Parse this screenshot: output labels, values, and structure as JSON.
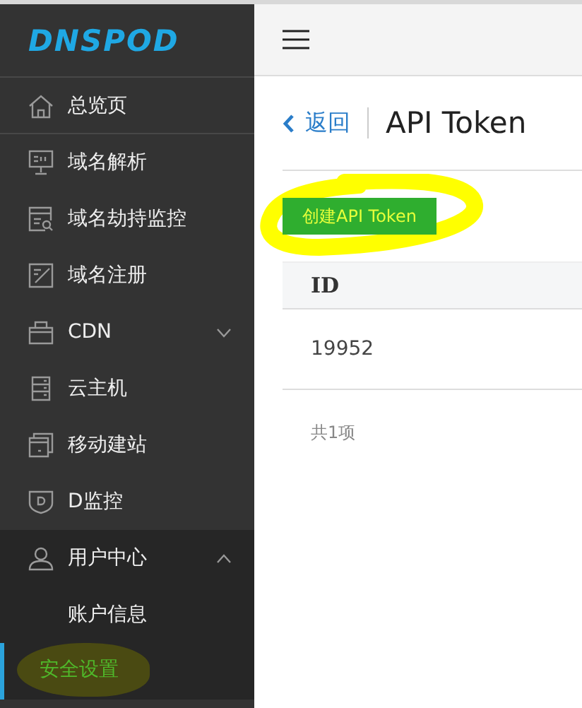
{
  "logo": "DNSPOD",
  "sidebar": {
    "items": [
      {
        "label": "总览页",
        "selected": false
      },
      {
        "label": "域名解析",
        "selected": false
      },
      {
        "label": "域名劫持监控",
        "selected": false
      },
      {
        "label": "域名注册",
        "selected": false
      },
      {
        "label": "CDN",
        "selected": false,
        "expanded": false
      },
      {
        "label": "云主机",
        "selected": false
      },
      {
        "label": "移动建站",
        "selected": false
      },
      {
        "label": "D监控",
        "selected": false
      },
      {
        "label": "用户中心",
        "selected": false,
        "expanded": true,
        "children": [
          {
            "label": "账户信息",
            "selected": false,
            "highlighted": false
          },
          {
            "label": "安全设置",
            "selected": true,
            "highlighted": true
          }
        ]
      }
    ]
  },
  "page": {
    "back": "返回",
    "title": "API Token",
    "create_button": {
      "label": "创建API Token",
      "highlighted": true
    },
    "table": {
      "columns": [
        "ID"
      ],
      "rows": [
        [
          "19952"
        ]
      ]
    },
    "footer": "共1项"
  }
}
